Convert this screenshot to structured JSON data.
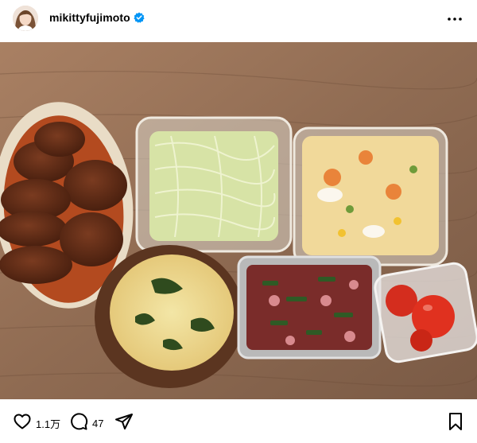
{
  "post": {
    "username": "mikittyfujimoto",
    "verified": true,
    "likes": "1.1万",
    "comments": "47"
  },
  "icons": {
    "verified": "verified-badge-icon",
    "more": "more-options-icon",
    "like": "heart-icon",
    "comment": "comment-bubble-icon",
    "share": "paper-plane-icon",
    "save": "bookmark-icon"
  },
  "colors": {
    "verified_badge": "#0095f6",
    "text": "#000000",
    "background": "#ffffff"
  }
}
